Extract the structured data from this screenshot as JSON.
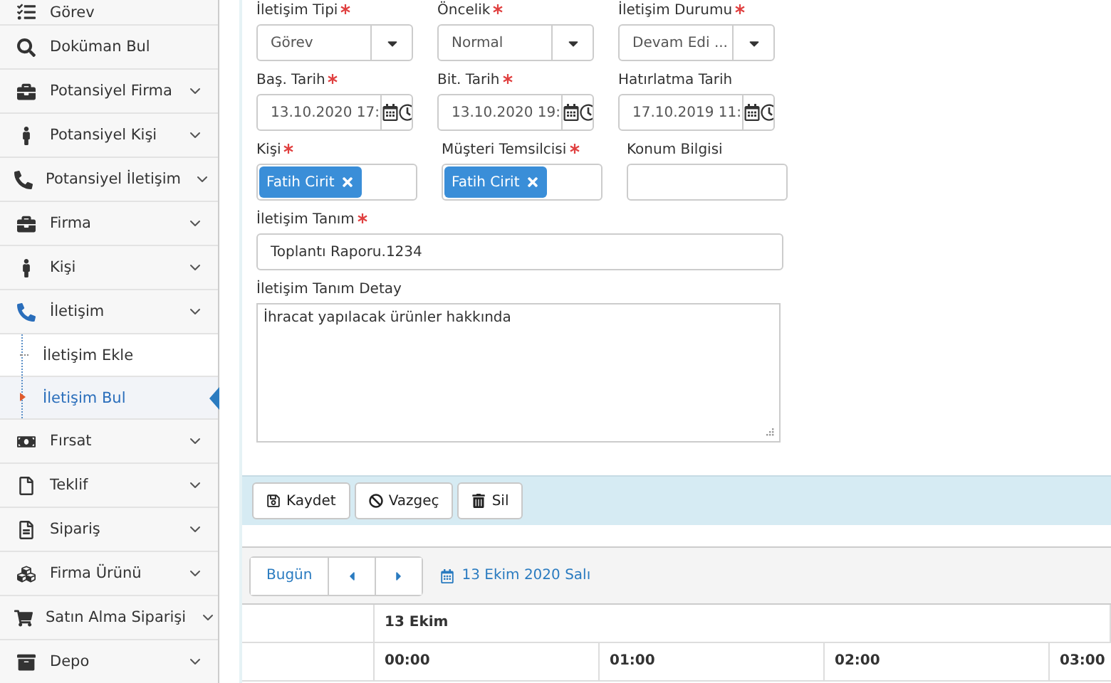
{
  "sidebar": {
    "items": [
      {
        "label": "Görev",
        "expandable": false,
        "selected": false
      },
      {
        "label": "Doküman Bul",
        "expandable": false,
        "selected": false
      },
      {
        "label": "Potansiyel Firma",
        "expandable": true,
        "selected": false
      },
      {
        "label": "Potansiyel Kişi",
        "expandable": true,
        "selected": false
      },
      {
        "label": "Potansiyel İletişim",
        "expandable": true,
        "selected": false
      },
      {
        "label": "Firma",
        "expandable": true,
        "selected": false
      },
      {
        "label": "Kişi",
        "expandable": true,
        "selected": false
      },
      {
        "label": "İletişim",
        "expandable": true,
        "selected": true,
        "children": [
          {
            "label": "İletişim Ekle",
            "selected": false
          },
          {
            "label": "İletişim Bul",
            "selected": true
          }
        ]
      },
      {
        "label": "Fırsat",
        "expandable": true,
        "selected": false
      },
      {
        "label": "Teklif",
        "expandable": true,
        "selected": false
      },
      {
        "label": "Sipariş",
        "expandable": true,
        "selected": false
      },
      {
        "label": "Firma Ürünü",
        "expandable": true,
        "selected": false
      },
      {
        "label": "Satın Alma Siparişi",
        "expandable": true,
        "selected": false
      },
      {
        "label": "Depo",
        "expandable": true,
        "selected": false
      }
    ]
  },
  "form": {
    "rows": [
      [
        {
          "label": "İletişim Tipi",
          "required": true,
          "kind": "select",
          "value": "Görev"
        },
        {
          "label": "Öncelik",
          "required": true,
          "kind": "select",
          "value": "Normal"
        },
        {
          "label": "İletişim Durumu",
          "required": true,
          "kind": "select",
          "value": "Devam Edi ..."
        }
      ],
      [
        {
          "label": "Baş. Tarih",
          "required": true,
          "kind": "datetime",
          "value": "13.10.2020 17:"
        },
        {
          "label": "Bit. Tarih",
          "required": true,
          "kind": "datetime",
          "value": "13.10.2020 19:"
        },
        {
          "label": "Hatırlatma Tarih",
          "required": false,
          "kind": "datetime",
          "value": "17.10.2019 11:"
        }
      ],
      [
        {
          "label": "Kişi",
          "required": true,
          "kind": "tags",
          "tags": [
            "Fatih Cirit"
          ]
        },
        {
          "label": "Müşteri Temsilcisi",
          "required": true,
          "kind": "tags",
          "tags": [
            "Fatih Cirit"
          ]
        },
        {
          "label": "Konum Bilgisi",
          "required": false,
          "kind": "text"
        }
      ]
    ],
    "title_field": {
      "label": "İletişim Tanım",
      "required": true,
      "value": "Toplantı Raporu.1234"
    },
    "detail_field": {
      "label": "İletişim Tanım Detay",
      "required": false,
      "value": "İhracat yapılacak ürünler hakkında"
    }
  },
  "actions": [
    {
      "label": "Kaydet"
    },
    {
      "label": "Vazgeç"
    },
    {
      "label": "Sil"
    }
  ],
  "scheduler": {
    "today": "Bugün",
    "date": "13 Ekim 2020 Salı",
    "day": "13 Ekim",
    "hours": [
      "00:00",
      "01:00",
      "02:00",
      "03:00"
    ]
  }
}
